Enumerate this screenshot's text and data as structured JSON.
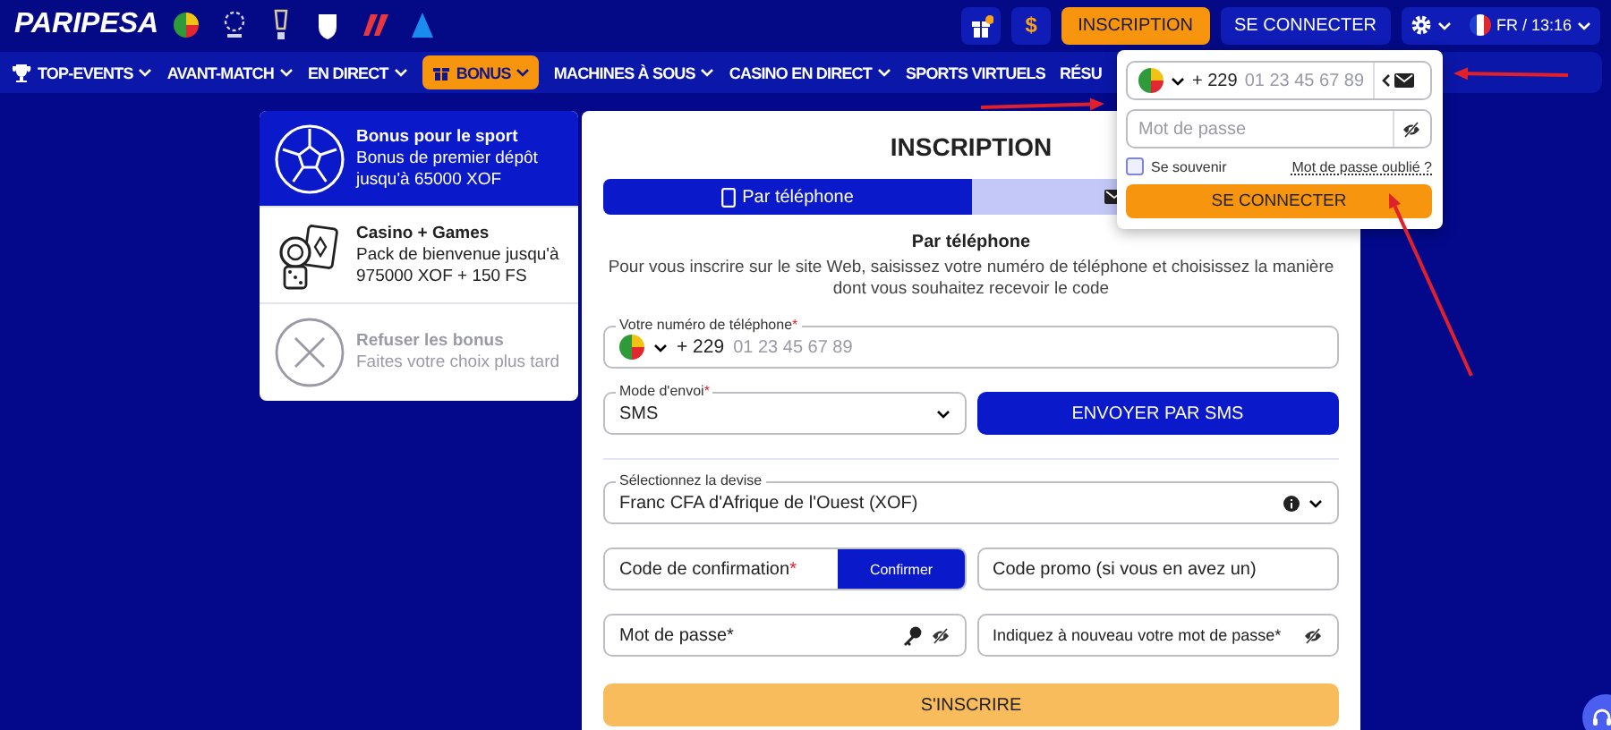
{
  "header": {
    "logo": "PARIPESA",
    "currency_button": "$",
    "register_button": "INSCRIPTION",
    "login_button": "SE CONNECTER",
    "locale": "FR / 13:16"
  },
  "nav": [
    {
      "label": "TOP-EVENTS",
      "dropdown": true,
      "highlighted": false
    },
    {
      "label": "AVANT-MATCH",
      "dropdown": true,
      "highlighted": false
    },
    {
      "label": "EN DIRECT",
      "dropdown": true,
      "highlighted": false
    },
    {
      "label": "BONUS",
      "dropdown": true,
      "highlighted": true
    },
    {
      "label": "MACHINES À SOUS",
      "dropdown": true,
      "highlighted": false
    },
    {
      "label": "CASINO EN DIRECT",
      "dropdown": true,
      "highlighted": false
    },
    {
      "label": "SPORTS VIRTUELS",
      "dropdown": false,
      "highlighted": false
    },
    {
      "label": "RÉSU",
      "dropdown": false,
      "highlighted": false
    }
  ],
  "bonus_options": [
    {
      "kind": "sport",
      "title": "Bonus pour le sport",
      "description": "Bonus de premier dépôt jusqu'à 65000 XOF",
      "selected": true
    },
    {
      "kind": "casino",
      "title": "Casino + Games",
      "description": "Pack de bienvenue jusqu'à 975000 XOF + 150 FS",
      "selected": false
    },
    {
      "kind": "refuse",
      "title": "Refuser les bonus",
      "description": "Faites votre choix plus tard",
      "selected": false
    }
  ],
  "registration": {
    "title": "INSCRIPTION",
    "tabs": [
      {
        "label": "Par téléphone",
        "selected": true
      },
      {
        "selected": false
      }
    ],
    "subtitle": "Par téléphone",
    "intro": "Pour vous inscrire sur le site Web, saisissez votre numéro de téléphone et choisissez la manière dont vous souhaitez recevoir le code",
    "phone": {
      "label": "Votre numéro de téléphone",
      "required_mark": "*",
      "code": "+ 229",
      "placeholder": "01 23 45 67 89"
    },
    "send_mode": {
      "label": "Mode d'envoi",
      "required_mark": "*",
      "value": "SMS"
    },
    "send_button": "ENVOYER PAR SMS",
    "currency": {
      "label": "Sélectionnez la devise",
      "value": "Franc CFA d'Afrique de l'Ouest (XOF)"
    },
    "confirmation": {
      "placeholder": "Code de confirmation",
      "required_mark": "*",
      "button": "Confirmer"
    },
    "promo": {
      "placeholder": "Code promo (si vous en avez un)"
    },
    "password": {
      "placeholder": "Mot de passe*"
    },
    "password_repeat": {
      "placeholder": "Indiquez à nouveau votre mot de passe*"
    },
    "submit_button": "S'INSCRIRE"
  },
  "login_popup": {
    "phone_code": "+ 229",
    "phone_placeholder": "01 23 45 67 89",
    "password_placeholder": "Mot de passe",
    "remember": {
      "label": "Se souvenir",
      "checked": false
    },
    "forgot_link": "Mot de passe oublié ?",
    "submit_button": "SE CONNECTER"
  },
  "annotations": [
    {
      "kind": "arrow"
    },
    {
      "kind": "arrow"
    },
    {
      "kind": "arrow"
    }
  ]
}
